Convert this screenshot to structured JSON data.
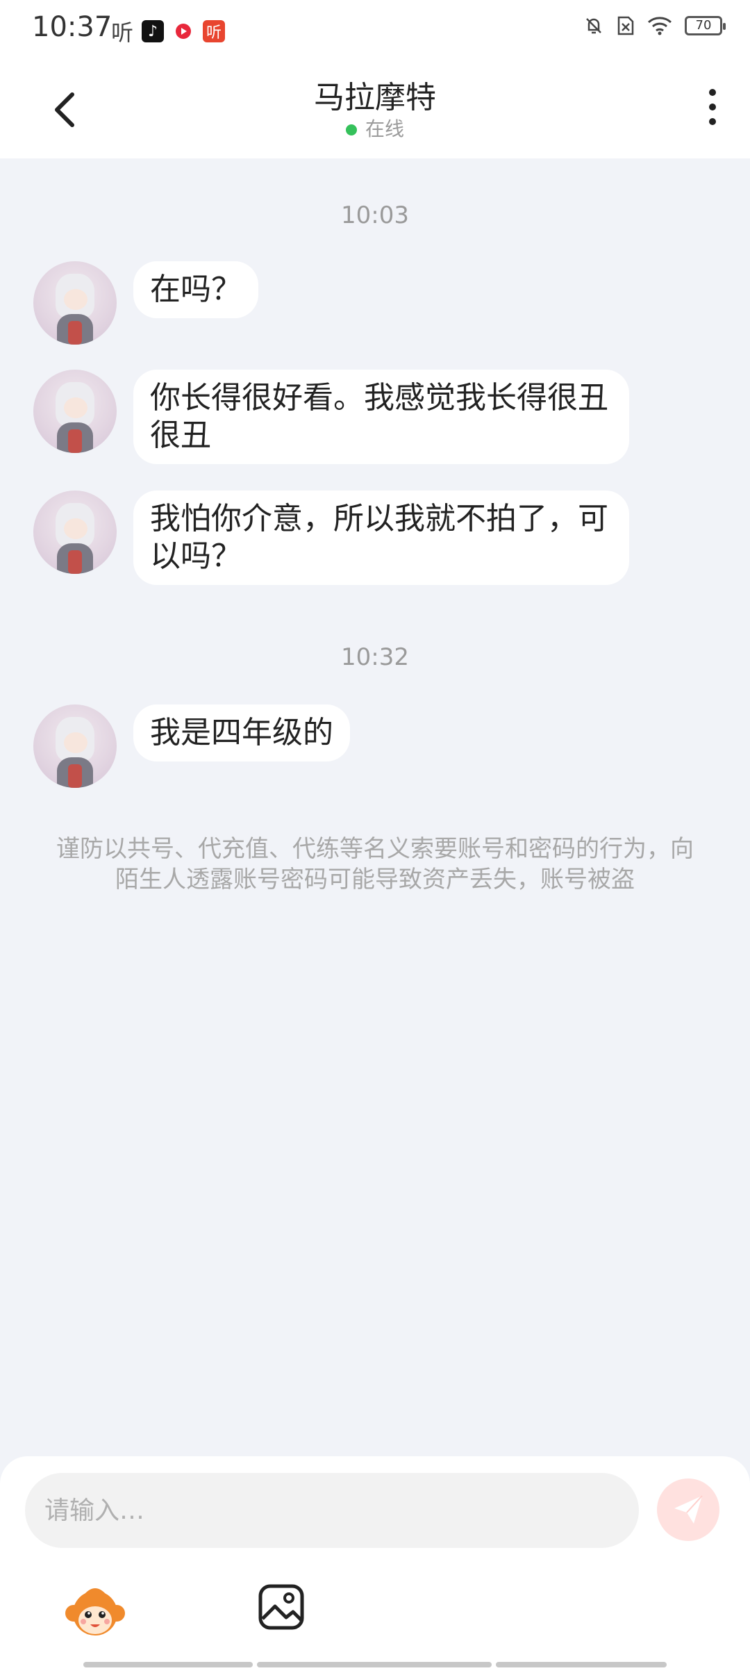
{
  "status_bar": {
    "time": "10:37",
    "listen_text": "听",
    "listen_app_text": "听",
    "battery": "70"
  },
  "header": {
    "title": "马拉摩特",
    "presence": "在线"
  },
  "chat": {
    "groups": [
      {
        "timestamp": "10:03",
        "messages": [
          "在吗？",
          "你长得很好看。我感觉我长得很丑很丑",
          "我怕你介意，所以我就不拍了，可以吗？"
        ]
      },
      {
        "timestamp": "10:32",
        "messages": [
          "我是四年级的"
        ]
      }
    ],
    "warning": "谨防以共号、代充值、代练等名义索要账号和密码的行为，向陌生人透露账号密码可能导致资产丢失，账号被盗"
  },
  "composer": {
    "placeholder": "请输入…"
  },
  "colors": {
    "background": "#f1f3f8",
    "online": "#35c15b",
    "send_disabled": "#ffe1df"
  }
}
